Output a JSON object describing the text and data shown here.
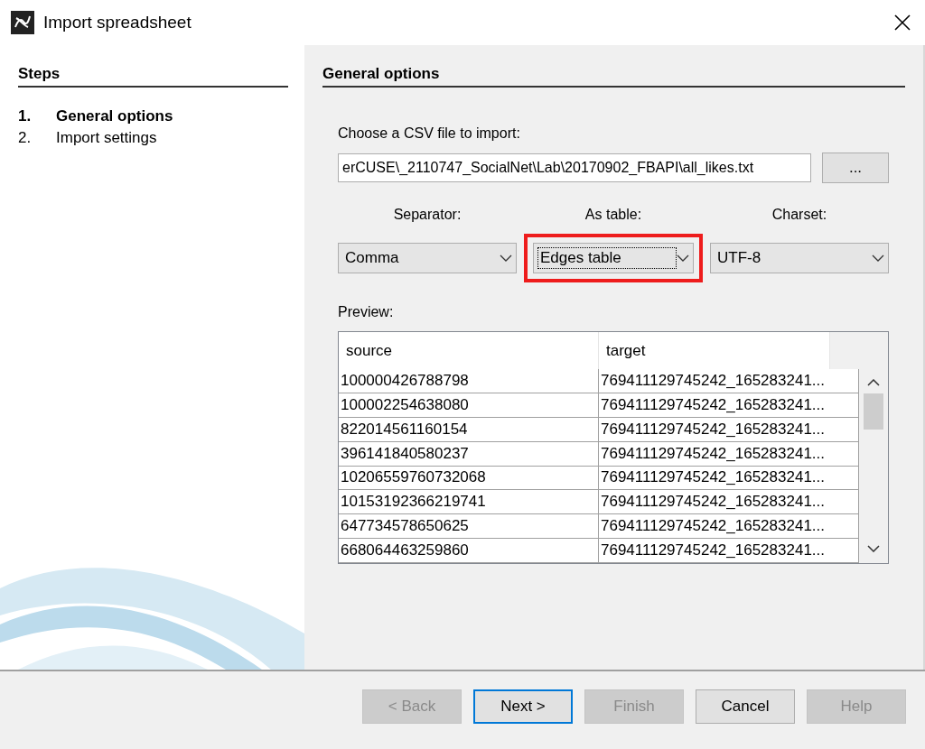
{
  "window": {
    "title": "Import spreadsheet"
  },
  "steps": {
    "title": "Steps",
    "items": [
      {
        "number": "1.",
        "label": "General options",
        "selected": true
      },
      {
        "number": "2.",
        "label": "Import settings",
        "selected": false
      }
    ]
  },
  "panel": {
    "title": "General options",
    "file_label": "Choose a CSV file to import:",
    "file_path": "erCUSE\\_2110747_SocialNet\\Lab\\20170902_FBAPI\\all_likes.txt",
    "browse_button": "...",
    "dropdowns": [
      {
        "label": "Separator:",
        "value": "Comma",
        "highlighted": false,
        "focused": false
      },
      {
        "label": "As table:",
        "value": "Edges table",
        "highlighted": true,
        "focused": true
      },
      {
        "label": "Charset:",
        "value": "UTF-8",
        "highlighted": false,
        "focused": false
      }
    ],
    "preview_label": "Preview:",
    "table": {
      "columns": [
        "source",
        "target"
      ],
      "rows": [
        [
          "100000426788798",
          "769411129745242_165283241..."
        ],
        [
          "100002254638080",
          "769411129745242_165283241..."
        ],
        [
          "822014561160154",
          "769411129745242_165283241..."
        ],
        [
          "396141840580237",
          "769411129745242_165283241..."
        ],
        [
          "10206559760732068",
          "769411129745242_165283241..."
        ],
        [
          "10153192366219741",
          "769411129745242_165283241..."
        ],
        [
          "647734578650625",
          "769411129745242_165283241..."
        ],
        [
          "668064463259860",
          "769411129745242_165283241..."
        ]
      ]
    }
  },
  "buttons": [
    {
      "label": "< Back",
      "disabled": true,
      "default": false
    },
    {
      "label": "Next >",
      "disabled": false,
      "default": true
    },
    {
      "label": "Finish",
      "disabled": true,
      "default": false
    },
    {
      "label": "Cancel",
      "disabled": false,
      "default": false
    },
    {
      "label": "Help",
      "disabled": true,
      "default": false
    }
  ]
}
